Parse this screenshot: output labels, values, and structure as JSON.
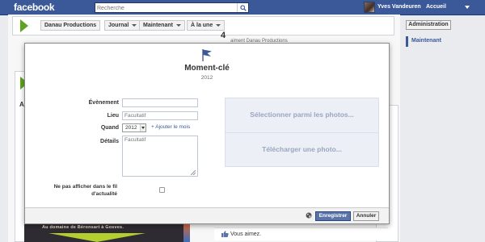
{
  "topbar": {
    "logo": "facebook",
    "search_placeholder": "Recherche",
    "user_name": "Yves Vandeuren",
    "home_label": "Accueil"
  },
  "page": {
    "breadcrumbs": [
      "Danau Productions",
      "Journal",
      "Maintenant",
      "À la une"
    ],
    "admin_label": "Administration",
    "now_label": "Maintenant",
    "likes_count": "4",
    "likes_text": "aiment Danau Productions",
    "bg_letter": "A",
    "image_caption": "Au domaine de Béronsart à Gosves.",
    "like_text": "Vous aimez."
  },
  "modal": {
    "title": "Moment-clé",
    "year": "2012",
    "labels": {
      "event": "Évènement",
      "place": "Lieu",
      "when": "Quand",
      "details": "Détails",
      "hide": "Ne pas afficher dans le fil d'actualité"
    },
    "event_value": "",
    "place_placeholder": "Facultatif",
    "year_selected": "2012",
    "add_month": "+ Ajouter le mois",
    "details_placeholder": "Facultatif",
    "photo_select": "Sélectionner parmi les photos...",
    "photo_upload": "Télécharger une photo...",
    "save_label": "Enregistrer",
    "cancel_label": "Annuler"
  },
  "colors": {
    "brand": "#3b5998",
    "accent_green": "#5fa31f",
    "photo_text": "#9aa6c1",
    "save_button": "#5b74a8"
  },
  "icons": [
    "search-icon",
    "flag-icon",
    "globe-icon",
    "like-icon",
    "chevron-down-icon"
  ]
}
